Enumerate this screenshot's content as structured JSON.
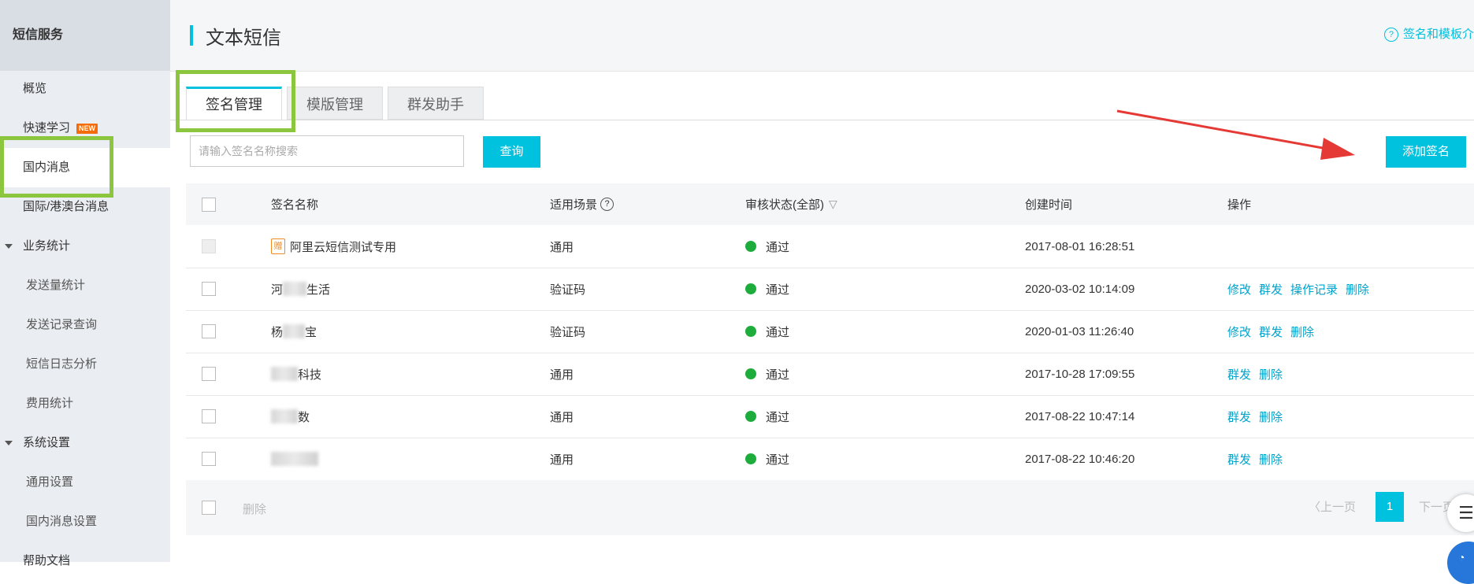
{
  "sidebar": {
    "title": "短信服务",
    "items": [
      {
        "label": "概览"
      },
      {
        "label": "快速学习",
        "badge": "NEW"
      },
      {
        "label": "国内消息"
      },
      {
        "label": "国际/港澳台消息"
      },
      {
        "label": "业务统计"
      },
      {
        "label": "发送量统计"
      },
      {
        "label": "发送记录查询"
      },
      {
        "label": "短信日志分析"
      },
      {
        "label": "费用统计"
      },
      {
        "label": "系统设置"
      },
      {
        "label": "通用设置"
      },
      {
        "label": "国内消息设置"
      },
      {
        "label": "帮助文档"
      }
    ]
  },
  "header": {
    "title": "文本短信",
    "help_link": "签名和模板介"
  },
  "tabs": [
    {
      "label": "签名管理"
    },
    {
      "label": "模版管理"
    },
    {
      "label": "群发助手"
    }
  ],
  "search": {
    "placeholder": "请输入签名名称搜索",
    "button": "查询"
  },
  "add_button": "添加签名",
  "table": {
    "headers": {
      "name": "签名名称",
      "scene": "适用场景",
      "status": "审核状态(全部)",
      "created": "创建时间",
      "ops": "操作"
    },
    "rows": [
      {
        "name": "阿里云短信测试专用",
        "scene": "通用",
        "status": "通过",
        "created": "2017-08-01 16:28:51",
        "ops": []
      },
      {
        "name_prefix": "河",
        "name_suffix": "生活",
        "scene": "验证码",
        "status": "通过",
        "created": "2020-03-02 10:14:09",
        "ops": [
          "修改",
          "群发",
          "操作记录",
          "删除"
        ]
      },
      {
        "name_prefix": "杨",
        "name_suffix": "宝",
        "scene": "验证码",
        "status": "通过",
        "created": "2020-01-03 11:26:40",
        "ops": [
          "修改",
          "群发",
          "删除"
        ]
      },
      {
        "name_suffix": "科技",
        "scene": "通用",
        "status": "通过",
        "created": "2017-10-28 17:09:55",
        "ops": [
          "群发",
          "删除"
        ]
      },
      {
        "name_suffix": "数",
        "scene": "通用",
        "status": "通过",
        "created": "2017-08-22 10:47:14",
        "ops": [
          "群发",
          "删除"
        ]
      },
      {
        "name_suffix": "",
        "scene": "通用",
        "status": "通过",
        "created": "2017-08-22 10:46:20",
        "ops": [
          "群发",
          "删除"
        ]
      }
    ]
  },
  "footer": {
    "delete": "删除",
    "prev": "上一页",
    "page": "1",
    "next": "下一页"
  },
  "colors": {
    "accent": "#00c1de",
    "highlight": "#8cc63f",
    "status_ok": "#1ead3c",
    "arrow": "#e53935"
  }
}
